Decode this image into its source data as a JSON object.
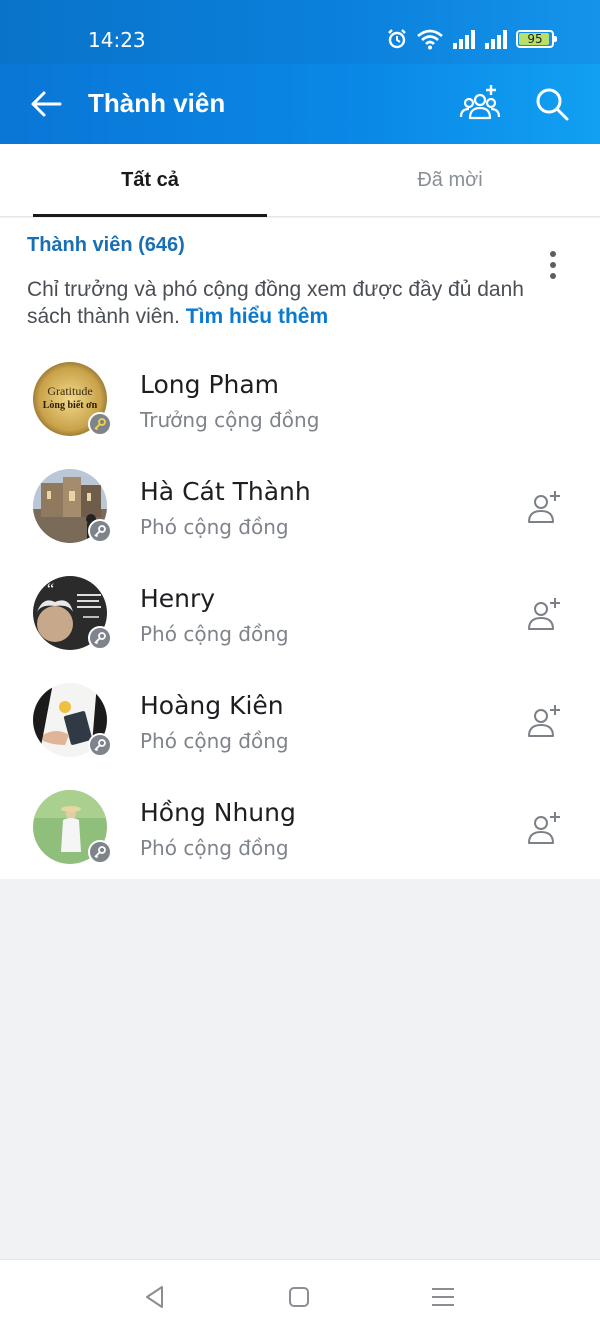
{
  "status_bar": {
    "time": "14:23",
    "battery": "95",
    "battery_fraction": 0.95
  },
  "header": {
    "title": "Thành viên"
  },
  "tabs": [
    {
      "label": "Tất cả",
      "active": true
    },
    {
      "label": "Đã mời",
      "active": false
    }
  ],
  "members_section": {
    "title": "Thành viên (646)",
    "notice": "Chỉ trưởng và phó cộng đồng xem được đầy đủ danh sách thành viên.",
    "learn_more": "Tìm hiểu thêm"
  },
  "members": [
    {
      "name": "Long Pham",
      "role": "Trưởng cộng đồng",
      "avatar_text_1": "Gratitude",
      "avatar_text_2": "Lòng biết ơn"
    },
    {
      "name": "Hà Cát Thành",
      "role": "Phó cộng đồng"
    },
    {
      "name": "Henry",
      "role": "Phó cộng đồng"
    },
    {
      "name": "Hoàng Kiên",
      "role": "Phó cộng đồng"
    },
    {
      "name": "Hồng Nhung",
      "role": "Phó cộng đồng"
    }
  ],
  "colors": {
    "header_blue": "#0a88e6",
    "link_blue": "#0a7ad0",
    "title_blue": "#1a6fb3"
  }
}
